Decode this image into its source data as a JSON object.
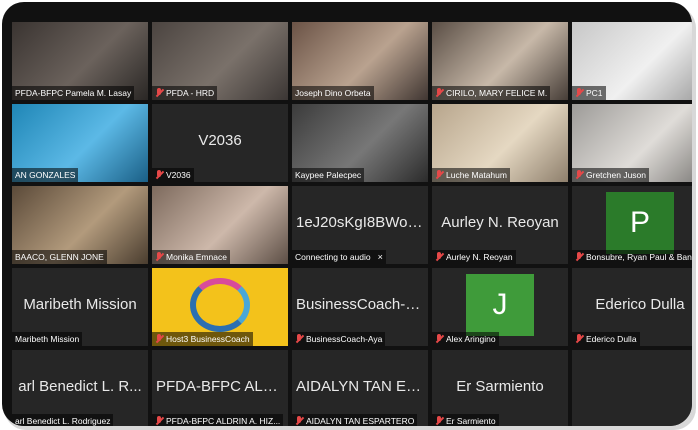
{
  "participants": [
    {
      "label": "PFDA-BFPC Pamela M. Lasay",
      "muted": false
    },
    {
      "label": "PFDA - HRD",
      "muted": true
    },
    {
      "label": "Joseph Dino Orbeta",
      "muted": false
    },
    {
      "label": "CIRILO, MARY FELICE M.",
      "muted": true
    },
    {
      "label": "PC1",
      "muted": true
    },
    {
      "label": "AN GONZALES",
      "muted": false
    },
    {
      "center": "V2036",
      "label": "V2036",
      "muted": true
    },
    {
      "label": "Kaypee Palecpec",
      "muted": false
    },
    {
      "label": "Luche Matahum",
      "muted": true
    },
    {
      "label": "Gretchen Juson",
      "muted": true
    },
    {
      "label": "BAACO, GLENN JONE",
      "muted": false
    },
    {
      "label": "Monika Emnace",
      "muted": true
    },
    {
      "center": "1eJ20sKgI8BWoQ...",
      "label": "Connecting to audio",
      "muted": false,
      "close": "×"
    },
    {
      "center": "Aurley N. Reoyan",
      "label": "Aurley N. Reoyan",
      "muted": true
    },
    {
      "avatar_letter": "P",
      "avatar_color": "#2b7b2a",
      "label": "Bonsubre, Ryan Paul & Ban...",
      "muted": true
    },
    {
      "center": "Maribeth Mission",
      "label": "Maribeth Mission",
      "muted": false
    },
    {
      "label": "Host3 BusinessCoach",
      "muted": true
    },
    {
      "center": "BusinessCoach-A...",
      "label": "BusinessCoach-Aya",
      "muted": true
    },
    {
      "avatar_letter": "J",
      "avatar_color": "#3f9b3a",
      "label": "Alex Aringino",
      "muted": true
    },
    {
      "center": "Ederico Dulla",
      "label": "Ederico Dulla",
      "muted": true
    },
    {
      "center": "arl Benedict L. R...",
      "label": "arl Benedict L. Rodriguez",
      "muted": false
    },
    {
      "center": "PFDA-BFPC ALD...",
      "label": "PFDA-BFPC ALDRIN A. HIZ...",
      "muted": true
    },
    {
      "center": "AIDALYN TAN ES...",
      "label": "AIDALYN TAN ESPARTERO",
      "muted": true
    },
    {
      "center": "Er Sarmiento",
      "label": "Er Sarmiento",
      "muted": true
    },
    {
      "center": "",
      "label": "",
      "muted": false
    }
  ],
  "colors": {
    "active_border": "#b9e15a",
    "tile_bg": "#262626",
    "mute_red": "#e54848"
  }
}
